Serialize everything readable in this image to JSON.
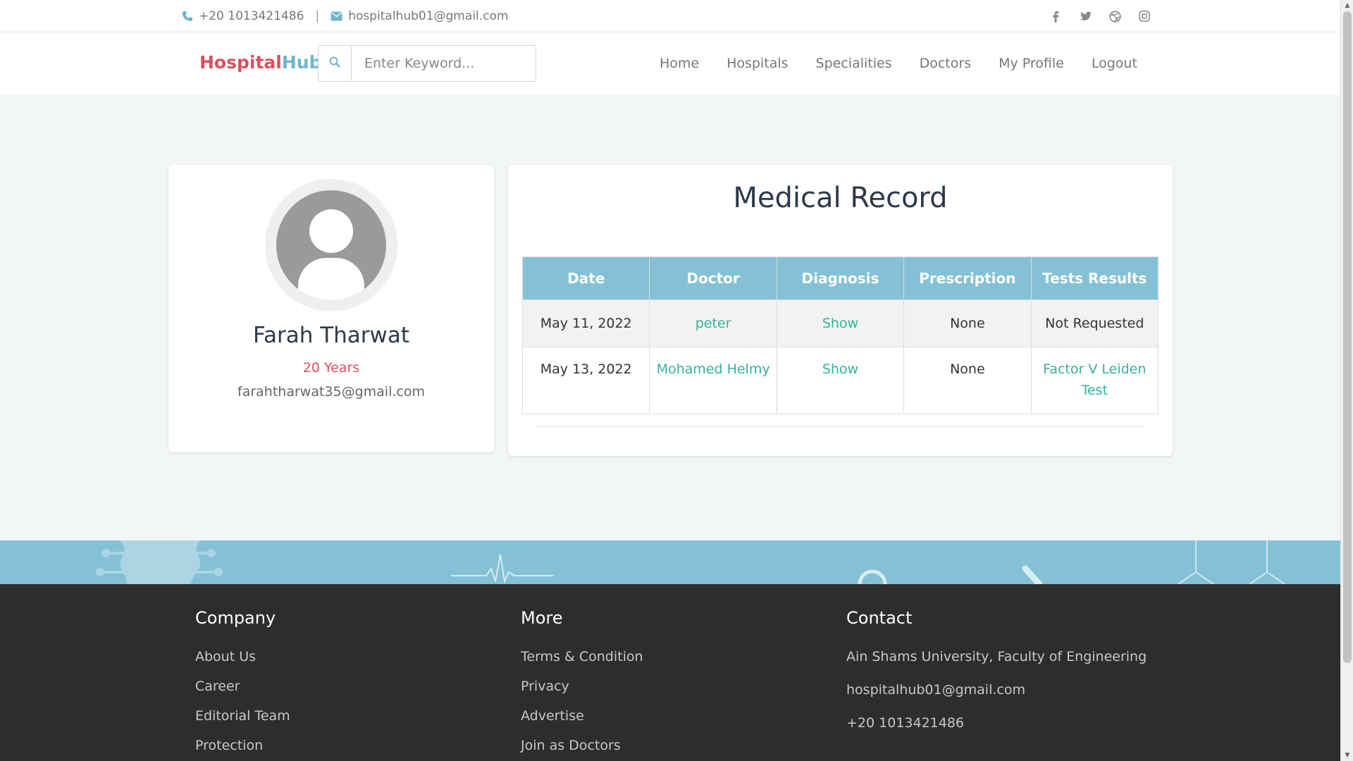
{
  "topbar": {
    "phone": "+20 1013421486",
    "email": "hospitalhub01@gmail.com",
    "social": [
      "facebook-icon",
      "twitter-icon",
      "dribbble-icon",
      "instagram-icon"
    ]
  },
  "navbar": {
    "logo_part1": "Hospital",
    "logo_part2": "Hub",
    "search_placeholder": "Enter Keyword...",
    "links": [
      "Home",
      "Hospitals",
      "Specialities",
      "Doctors",
      "My Profile",
      "Logout"
    ]
  },
  "profile": {
    "name": "Farah Tharwat",
    "age": "20 Years",
    "email": "farahtharwat35@gmail.com"
  },
  "record": {
    "title": "Medical Record",
    "columns": [
      "Date",
      "Doctor",
      "Diagnosis",
      "Prescription",
      "Tests Results"
    ],
    "rows": [
      {
        "date": "May 11, 2022",
        "doctor": "peter",
        "diagnosis": "Show",
        "prescription": "None",
        "tests": "Not Requested"
      },
      {
        "date": "May 13, 2022",
        "doctor": "Mohamed Helmy",
        "diagnosis": "Show",
        "prescription": "None",
        "tests": "Factor V Leiden Test"
      }
    ]
  },
  "footer": {
    "company": {
      "title": "Company",
      "links": [
        "About Us",
        "Career",
        "Editorial Team",
        "Protection"
      ]
    },
    "more": {
      "title": "More",
      "links": [
        "Terms & Condition",
        "Privacy",
        "Advertise",
        "Join as Doctors"
      ]
    },
    "contact": {
      "title": "Contact",
      "address": "Ain Shams University, Faculty of Engineering",
      "email": "hospitalhub01@gmail.com",
      "phone": "+20 1013421486"
    }
  },
  "colors": {
    "brand_red": "#d9505e",
    "brand_blue": "#6fb4d0",
    "link_green": "#35b19e",
    "table_header": "#84c1d6",
    "footer_bg": "#2d2d2d"
  }
}
